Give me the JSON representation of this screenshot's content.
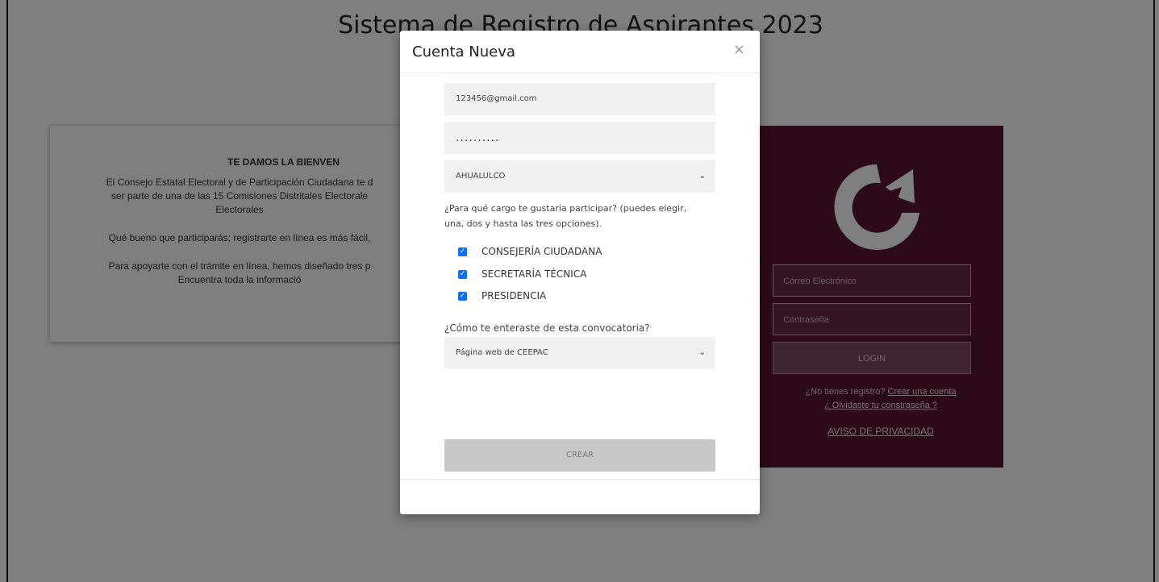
{
  "page": {
    "title": "Sistema de Registro de Aspirantes 2023"
  },
  "welcome": {
    "title": "TE DAMOS LA BIENVEN",
    "para1_line1": "El Consejo Estatal Electoral y de Participación Ciudadana te d",
    "para1_line2": "ser parte de una de las 15 Comisiones Distritales Electorale",
    "para1_line3": "Electorales",
    "para2": "Qué bueno que participarás; registrarte en línea es más fácil,",
    "para3_line1": "Para apoyarte con el trámite en línea, hemos diseñado tres p",
    "para3_line2": "Encuentra toda la informació"
  },
  "login": {
    "email_placeholder": "Correo Electrónico",
    "password_placeholder": "Contraseña",
    "login_label": "LOGIN",
    "no_account_text": "¿No tienes registro?",
    "create_account_link": "Crear una cuenta",
    "forgot_password_link": "¿ Olvidaste tu constraseña ?",
    "privacy_link": "AVISO DE PRIVACIDAD",
    "panel_color": "#5a1432"
  },
  "modal": {
    "title": "Cuenta Nueva",
    "close_label": "×",
    "email_value": "123456@gmail.com",
    "password_value": "..........",
    "municipality_value": "AHUALULCO",
    "question_cargo": "¿Para qué cargo te gustaría participar? (puedes elegir, una, dos y hasta las tres opciones).",
    "options": [
      {
        "label": "CONSEJERÍA CIUDADANA",
        "checked": true
      },
      {
        "label": "SECRETARÍA TÉCNICA",
        "checked": true
      },
      {
        "label": "PRESIDENCIA",
        "checked": true
      }
    ],
    "question_source": "¿Cómo te enteraste de esta convocatoria?",
    "source_value": "Página web de CEEPAC",
    "create_label": "CREAR",
    "checkbox_color": "#0d6efd"
  }
}
